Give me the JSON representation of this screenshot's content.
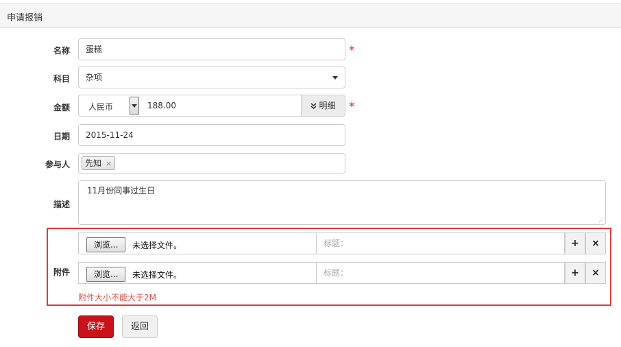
{
  "panel": {
    "title": "申请报销"
  },
  "form": {
    "name": {
      "label": "名称",
      "value": "蛋糕",
      "required_mark": "*"
    },
    "subject": {
      "label": "科目",
      "value": "杂项"
    },
    "amount": {
      "label": "金额",
      "currency": "人民币",
      "value": "188.00",
      "detail_label": "明细",
      "detail_icon": "double-chevron-down",
      "required_mark": "*"
    },
    "date": {
      "label": "日期",
      "value": "2015-11-24"
    },
    "participants": {
      "label": "参与人",
      "tags": [
        {
          "name": "先知",
          "remove": "×"
        }
      ]
    },
    "description": {
      "label": "描述",
      "value": "11月份同事过生日"
    },
    "attachments": {
      "label": "附件",
      "rows": [
        {
          "browse_label": "浏览...",
          "file_status": "未选择文件。",
          "title_placeholder": "标题：",
          "add": "+",
          "remove": "×"
        },
        {
          "browse_label": "浏览...",
          "file_status": "未选择文件。",
          "title_placeholder": "标题：",
          "add": "+",
          "remove": "×"
        }
      ],
      "warning": "附件大小不能大于2M"
    }
  },
  "actions": {
    "save": "保存",
    "back": "返回"
  },
  "colors": {
    "primary": "#c9121a",
    "required": "#d9534f",
    "highlight_border": "#e03a3a"
  }
}
